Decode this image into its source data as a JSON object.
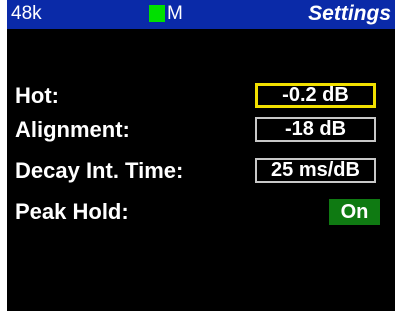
{
  "status_bar": {
    "sample_rate": "48k",
    "mode": "M",
    "title": "Settings",
    "indicator_color": "#00e000",
    "background_color": "#0a2aa8"
  },
  "settings": {
    "hot": {
      "label": "Hot:",
      "value": "-0.2 dB",
      "selected": true
    },
    "alignment": {
      "label": "Alignment:",
      "value": "-18 dB"
    },
    "decay": {
      "label": "Decay Int. Time:",
      "value": "25 ms/dB"
    },
    "peak_hold": {
      "label": "Peak Hold:",
      "value": "On",
      "color": "#0f7a12"
    }
  },
  "colors": {
    "selection_highlight": "#f2e000",
    "box_border": "#c8c8c8"
  }
}
